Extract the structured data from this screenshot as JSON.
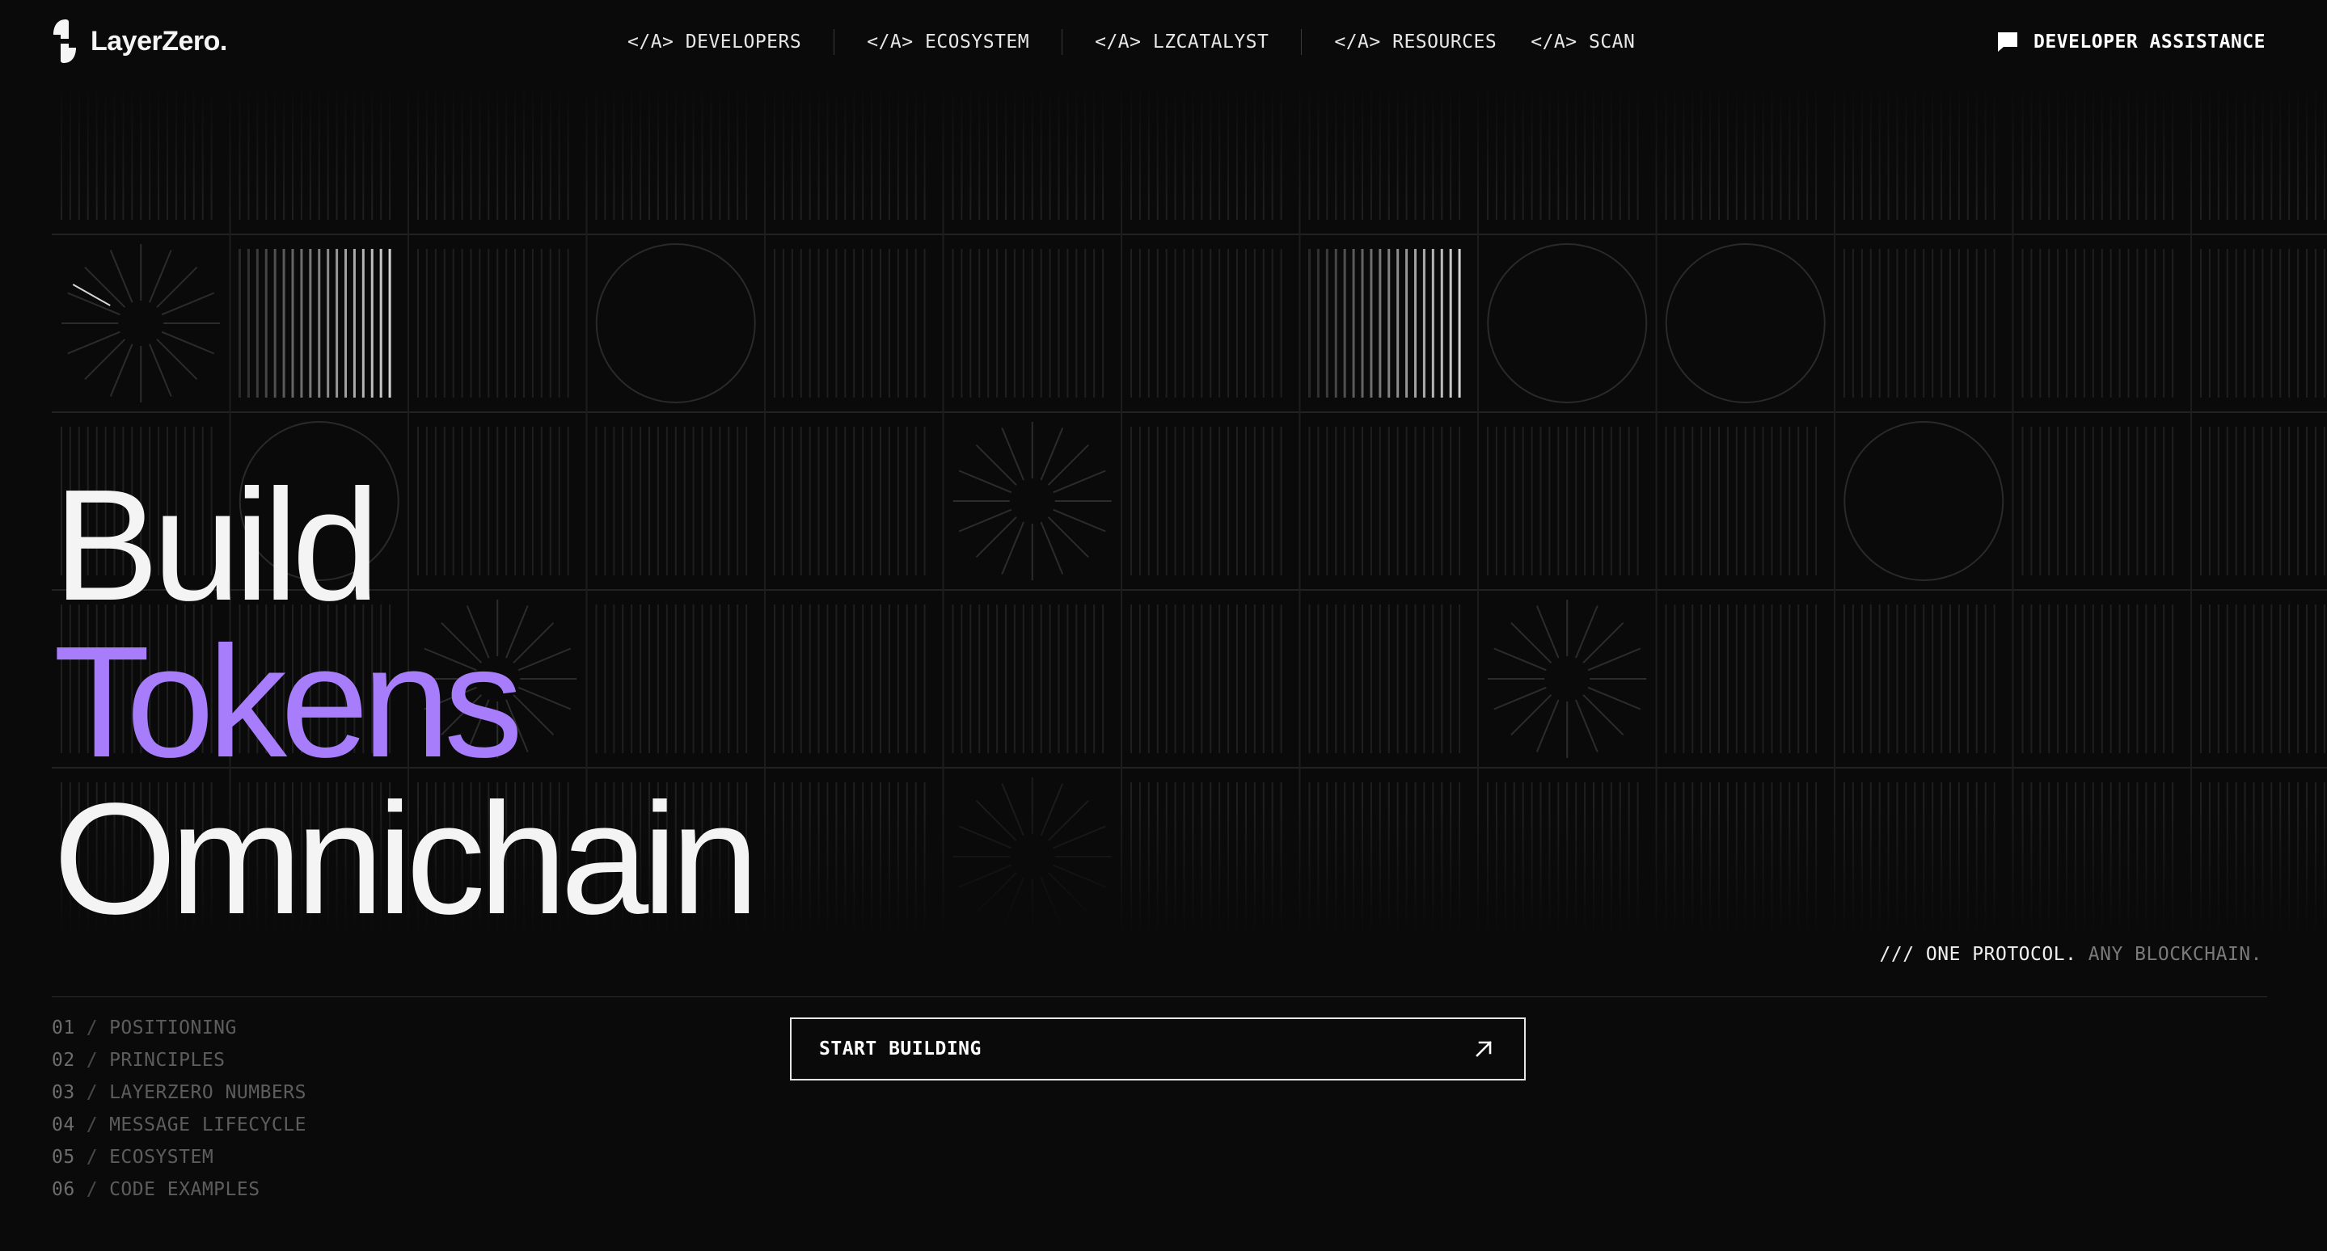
{
  "brand": {
    "name": "LayerZero.",
    "logo_icon": "layerzero-logo-icon"
  },
  "nav": {
    "items": [
      {
        "prefix": "</A>",
        "label": "DEVELOPERS"
      },
      {
        "prefix": "</A>",
        "label": "ECOSYSTEM"
      },
      {
        "prefix": "</A>",
        "label": "LZCATALYST"
      },
      {
        "prefix": "</A>",
        "label": "RESOURCES"
      },
      {
        "prefix": "</A>",
        "label": "SCAN"
      }
    ]
  },
  "assistance": {
    "label": "DEVELOPER ASSISTANCE",
    "icon": "chat-bubble-icon"
  },
  "hero": {
    "line1": "Build",
    "line2": "Tokens",
    "line3": "Omnichain",
    "tagline_primary": "/// ONE PROTOCOL.",
    "tagline_secondary": "ANY BLOCKCHAIN."
  },
  "sections": [
    {
      "num": "01",
      "sep": "/",
      "label": "POSITIONING"
    },
    {
      "num": "02",
      "sep": "/",
      "label": "PRINCIPLES"
    },
    {
      "num": "03",
      "sep": "/",
      "label": "LAYERZERO NUMBERS"
    },
    {
      "num": "04",
      "sep": "/",
      "label": "MESSAGE LIFECYCLE"
    },
    {
      "num": "05",
      "sep": "/",
      "label": "ECOSYSTEM"
    },
    {
      "num": "06",
      "sep": "/",
      "label": "CODE EXAMPLES"
    }
  ],
  "cta": {
    "label": "START BUILDING",
    "icon": "arrow-up-right-icon"
  },
  "colors": {
    "background": "#0a0a0a",
    "accent": "#a77dfb",
    "text": "#f4f4f4",
    "muted": "#5d5d5d"
  }
}
